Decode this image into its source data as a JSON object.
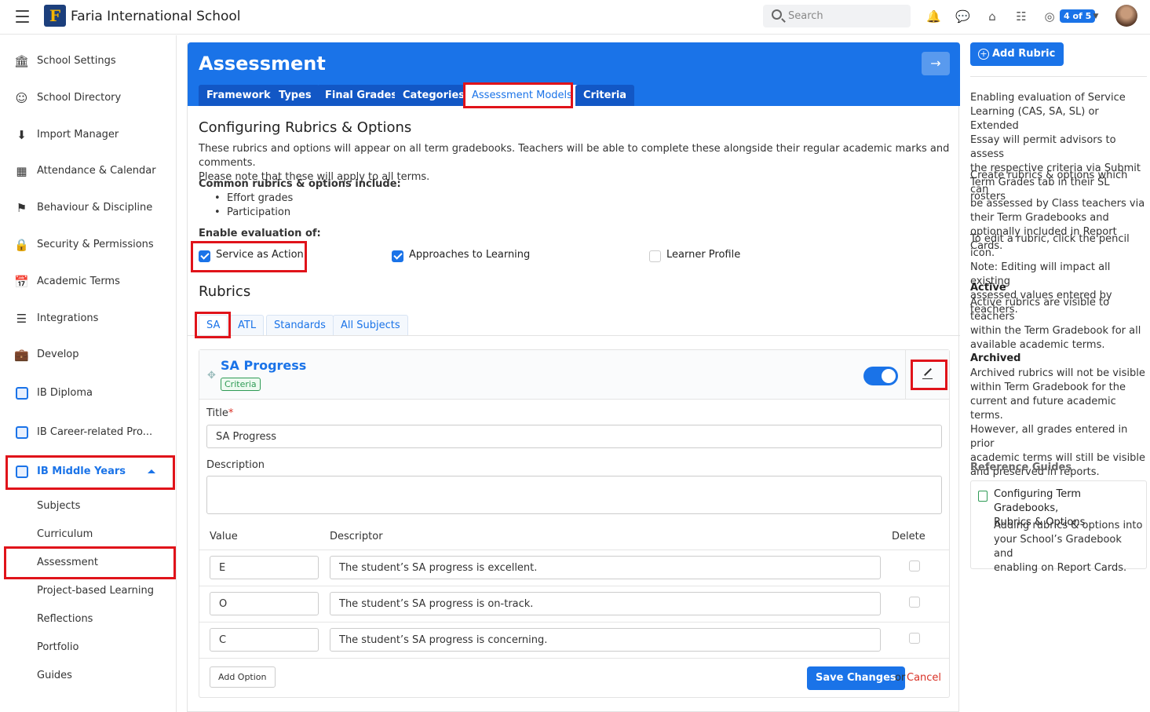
{
  "topbar": {
    "school_name": "Faria International School",
    "logo_letter": "F",
    "search_placeholder": "Search",
    "badge": "4 of 5",
    "icons": [
      "bell-icon",
      "chat-icon",
      "home-icon",
      "apps-grid-icon",
      "support-icon",
      "avatar"
    ]
  },
  "sidebar": {
    "items": [
      {
        "label": "School Settings",
        "icon": "bank-icon"
      },
      {
        "label": "School Directory",
        "icon": "people-icon"
      },
      {
        "label": "Import Manager",
        "icon": "import-icon"
      },
      {
        "label": "Attendance & Calendar",
        "icon": "calendar-icon"
      },
      {
        "label": "Behaviour & Discipline",
        "icon": "flag-icon"
      },
      {
        "label": "Security & Permissions",
        "icon": "lock-icon"
      },
      {
        "label": "Academic Terms",
        "icon": "calendar-clock-icon"
      },
      {
        "label": "Integrations",
        "icon": "layers-icon"
      },
      {
        "label": "Develop",
        "icon": "briefcase-icon"
      },
      {
        "label": "IB Diploma",
        "icon": "ib-dp-icon"
      },
      {
        "label": "IB Career-related Pro...",
        "icon": "ib-cp-icon"
      },
      {
        "label": "IB Middle Years",
        "icon": "ib-myp-icon"
      }
    ],
    "subitems": [
      "Subjects",
      "Curriculum",
      "Assessment",
      "Project-based Learning",
      "Reflections",
      "Portfolio",
      "Guides"
    ]
  },
  "header": {
    "title": "Assessment",
    "tabs": [
      "Framework",
      "Types",
      "Final Grades",
      "Categories",
      "Assessment Models",
      "Criteria"
    ],
    "active_tab": "Assessment Models"
  },
  "content": {
    "section_title": "Configuring Rubrics & Options",
    "intro_line1": "These rubrics and options will appear on all term gradebooks. Teachers will be able to complete these alongside their regular academic marks and comments.",
    "intro_line2": "Please note that these will apply to all terms.",
    "common_heading": "Common rubrics & options include:",
    "common_items": [
      "Effort grades",
      "Participation"
    ],
    "enable_heading": "Enable evaluation of:",
    "enable_options": [
      {
        "label": "Service as Action",
        "checked": true
      },
      {
        "label": "Approaches to Learning",
        "checked": true
      },
      {
        "label": "Learner Profile",
        "checked": false
      }
    ],
    "rubrics_title": "Rubrics",
    "rubric_tabs": [
      "SA",
      "ATL",
      "Standards",
      "All Subjects"
    ],
    "active_rubric_tab": "SA"
  },
  "rubric": {
    "title": "SA Progress",
    "tag": "Criteria",
    "active": true,
    "title_label": "Title",
    "required_mark": "*",
    "title_value": "SA Progress",
    "description_label": "Description",
    "description_value": "",
    "columns": {
      "value": "Value",
      "descriptor": "Descriptor",
      "delete": "Delete"
    },
    "rows": [
      {
        "value": "E",
        "descriptor": "The student’s SA progress is excellent."
      },
      {
        "value": "O",
        "descriptor": "The student’s SA progress is on-track."
      },
      {
        "value": "C",
        "descriptor": "The student’s SA progress is concerning."
      }
    ],
    "add_option": "Add Option",
    "save": "Save Changes",
    "or": "or",
    "cancel": "Cancel"
  },
  "right_panel": {
    "add_button": "Add Rubric",
    "p1_lines": [
      "Enabling evaluation of Service",
      "Learning (CAS, SA, SL) or Extended",
      "Essay will permit advisors to assess",
      "the respective criteria via Submit",
      "Term Grades tab in their SL rosters"
    ],
    "p2_lines": [
      "Create rubrics & options which can",
      "be assessed by Class teachers via",
      "their Term Gradebooks and",
      "optionally included in Report Cards."
    ],
    "p3_lines": [
      "To edit a rubric, click the pencil icon.",
      "Note: Editing will impact all existing",
      "assessed values entered by teachers."
    ],
    "active_heading": "Active",
    "active_lines": [
      "Active rubrics are visible to teachers",
      "within the Term Gradebook for all",
      "available academic terms."
    ],
    "archived_heading": "Archived",
    "archived_lines": [
      "Archived rubrics will not be visible",
      "within Term Gradebook for the",
      "current and future academic terms.",
      "However, all grades entered in prior",
      "academic terms will still be visible",
      "and preserved in reports."
    ],
    "reference_heading": "Reference Guides",
    "ref_title_lines": [
      "Configuring Term Gradebooks,",
      "Rubrics & Options"
    ],
    "ref_desc_lines": [
      "Adding rubrics & options into",
      "your School’s Gradebook and",
      "enabling on Report Cards."
    ]
  },
  "colors": {
    "accent": "#1a73e8",
    "highlight": "#e0131a",
    "tag": "#2e9b55",
    "danger": "#d93025"
  }
}
